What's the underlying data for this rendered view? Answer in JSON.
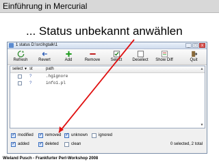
{
  "slide": {
    "header": "Einführung in Mercurial",
    "headline": "... Status unbekannt anwählen",
    "footer": "Wieland Pusch - Frankfurter Perl-Workshop 2008"
  },
  "window": {
    "title": "1 status  D:\\src\\hgtalk\\1",
    "controls": [
      "_",
      "□",
      "x"
    ]
  },
  "toolbar": [
    {
      "label": "Refresh",
      "icon": "refresh-icon"
    },
    {
      "label": "Revert",
      "icon": "revert-icon"
    },
    {
      "label": "Add",
      "icon": "add-icon"
    },
    {
      "label": "Remove",
      "icon": "remove-icon"
    },
    {
      "label": "Select",
      "icon": "select-icon"
    },
    {
      "label": "Deselect",
      "icon": "deselect-icon"
    },
    {
      "label": "Show Diff",
      "icon": "show-diff-icon"
    },
    {
      "label": "Quit",
      "icon": "quit-icon"
    }
  ],
  "list": {
    "columns": [
      "select",
      "st",
      "path"
    ],
    "rows": [
      {
        "status": "?",
        "path": ".hgignore"
      },
      {
        "status": "?",
        "path": "info1.pl"
      }
    ]
  },
  "filters": [
    {
      "label": "modified",
      "checked": true
    },
    {
      "label": "removed",
      "checked": true
    },
    {
      "label": "unknown",
      "checked": true
    },
    {
      "label": "ignored",
      "checked": false
    },
    {
      "label": "added",
      "checked": true
    },
    {
      "label": "deleted",
      "checked": true
    },
    {
      "label": "clean",
      "checked": false
    }
  ],
  "selection": "0 selected, 2 total",
  "colors": {
    "arrow": "#e01010",
    "header_bg": "#d8d8d8"
  }
}
